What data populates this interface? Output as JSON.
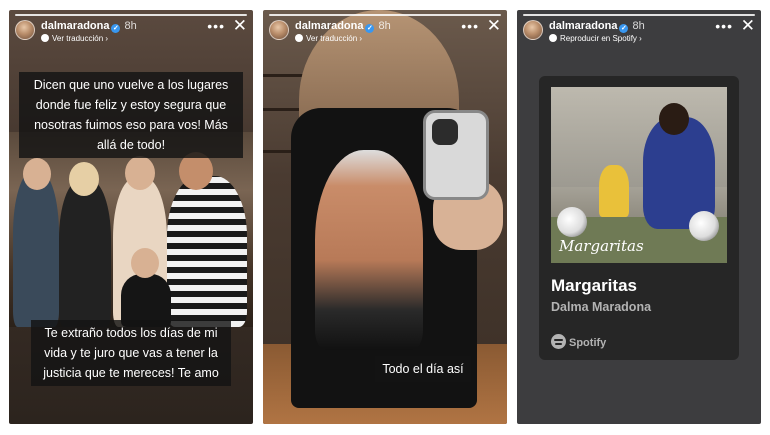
{
  "stories": [
    {
      "username": "dalmaradona",
      "time": "8h",
      "sub_label": "Ver traducción ›",
      "caption_top": "Dicen que uno vuelve a los lugares donde fue feliz y estoy segura que nosotras fuimos eso para vos! Más allá de todo!",
      "caption_bottom": "Te extraño todos los días de mi vida y te juro que vas a tener la justicia que te mereces! Te amo"
    },
    {
      "username": "dalmaradona",
      "time": "8h",
      "sub_label": "Ver traducción ›",
      "caption": "Todo el día así"
    },
    {
      "username": "dalmaradona",
      "time": "8h",
      "sub_label": "Reproducir en Spotify ›",
      "cover_text": "Margaritas",
      "song_title": "Margaritas",
      "artist": "Dalma Maradona",
      "service": "Spotify"
    }
  ],
  "icons": {
    "more": "•••",
    "close": "✕",
    "verified": "✓"
  },
  "colors": {
    "verified_badge": "#3897f0",
    "caption_bg": "#141414",
    "card_bg": "#262626",
    "muted_text": "#b3b3b3"
  }
}
